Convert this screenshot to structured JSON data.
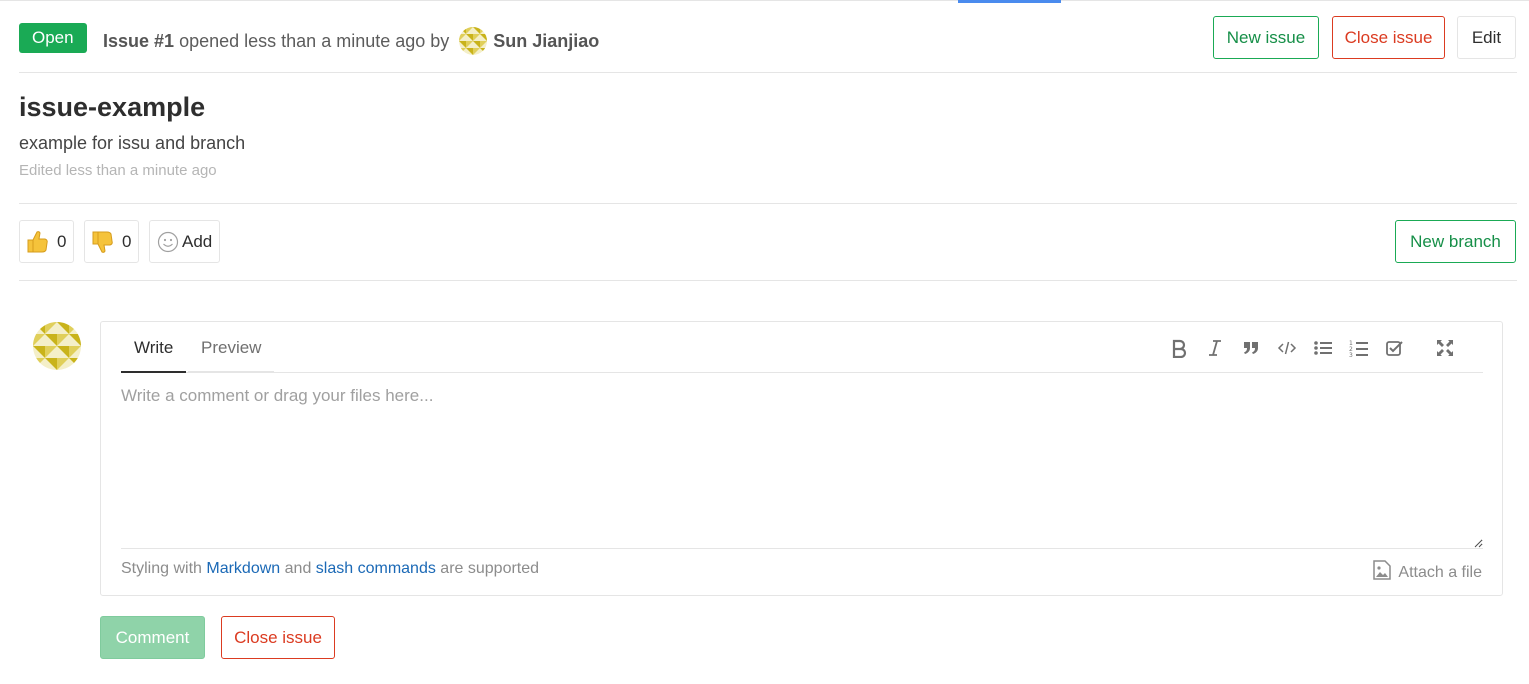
{
  "header": {
    "status": "Open",
    "issue_ref": "Issue #1",
    "opened_text": "opened less than a minute ago by",
    "author": "Sun Jianjiao",
    "new_issue_label": "New issue",
    "close_issue_label": "Close issue",
    "edit_label": "Edit"
  },
  "issue": {
    "title": "issue-example",
    "description": "example for issu and branch",
    "edited": "Edited less than a minute ago"
  },
  "awards": {
    "thumbs_up_count": "0",
    "thumbs_down_count": "0",
    "add_label": "Add",
    "new_branch_label": "New branch"
  },
  "comment": {
    "tabs": [
      "Write",
      "Preview"
    ],
    "placeholder": "Write a comment or drag your files here...",
    "footer_prefix": "Styling with",
    "markdown_link": "Markdown",
    "footer_and": "and",
    "slash_link": "slash commands",
    "footer_suffix": "are supported",
    "attach_label": "Attach a file",
    "submit_label": "Comment",
    "close_label": "Close issue",
    "toolbar_icons": [
      "bold-icon",
      "italic-icon",
      "quote-icon",
      "code-icon",
      "bullet-list-icon",
      "numbered-list-icon",
      "task-list-icon",
      "fullscreen-icon"
    ]
  },
  "colors": {
    "open_badge": "#1aaa55",
    "danger": "#db3b21",
    "link": "#1b69b6",
    "avatar_gold": "#c9b31a"
  }
}
